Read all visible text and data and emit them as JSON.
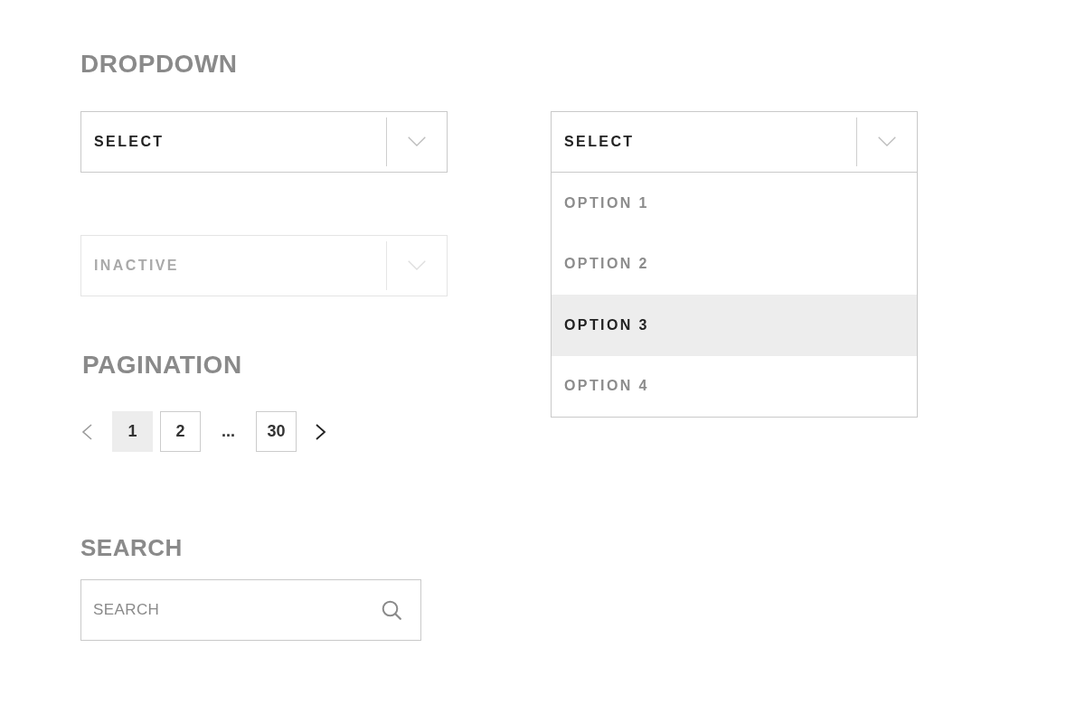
{
  "dropdown": {
    "title": "DROPDOWN",
    "column_1": [
      {
        "label": "SELECT",
        "disabled": false,
        "expanded": false
      },
      {
        "label": "INACTIVE",
        "disabled": true,
        "expanded": false
      }
    ],
    "column_2": [
      {
        "label": "SELECT",
        "disabled": false,
        "expanded": true,
        "options": [
          {
            "label": "OPTION 1",
            "selected": false
          },
          {
            "label": "OPTION 2",
            "selected": false
          },
          {
            "label": "OPTION 3",
            "selected": true
          },
          {
            "label": "OPTION 4",
            "selected": false
          }
        ]
      }
    ]
  },
  "pagination": {
    "title": "PAGINATION",
    "previous": {
      "disabled": true
    },
    "pages": [
      {
        "label": "1",
        "kind": "page",
        "selected": true
      },
      {
        "label": "2",
        "kind": "page",
        "selected": false
      },
      {
        "label": "...",
        "kind": "ellipsis",
        "selected": false
      },
      {
        "label": "30",
        "kind": "page",
        "selected": false
      }
    ],
    "next": {
      "disabled": false
    }
  },
  "search": {
    "title": "SEARCH",
    "placeholder": "SEARCH"
  }
}
